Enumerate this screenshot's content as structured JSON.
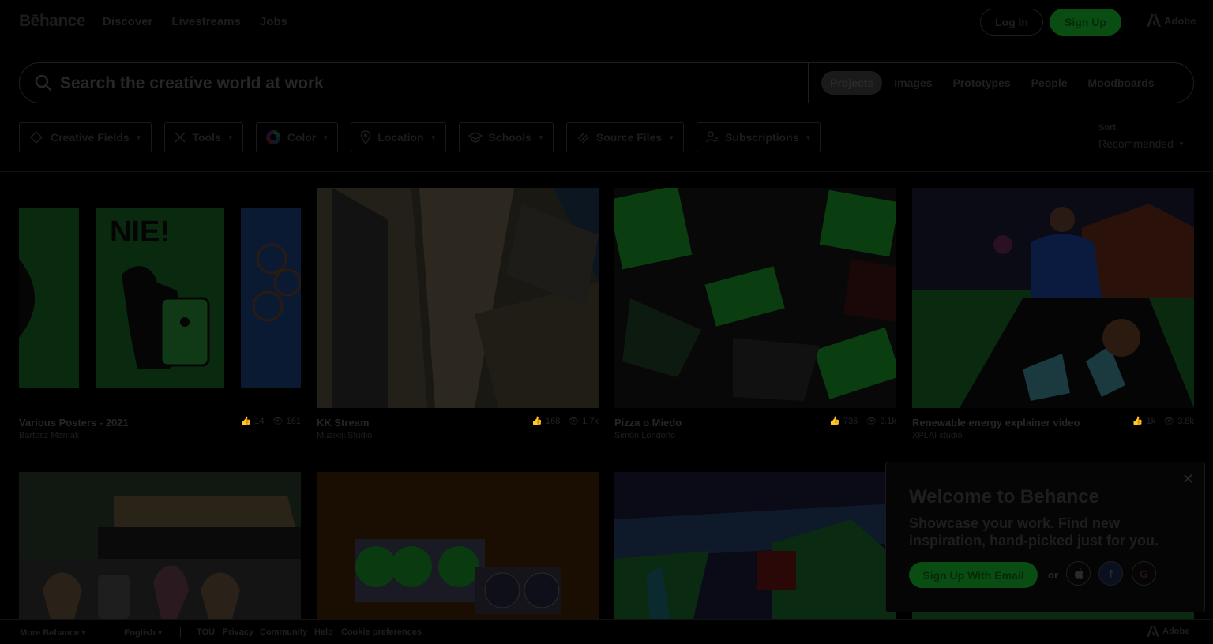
{
  "nav": {
    "logo": "Bēhance",
    "links": [
      "Discover",
      "Livestreams",
      "Jobs"
    ],
    "login": "Log In",
    "signup": "Sign Up",
    "adobe": "Adobe"
  },
  "search": {
    "placeholder": "Search the creative world at work",
    "tabs": [
      "Projects",
      "Images",
      "Prototypes",
      "People",
      "Moodboards"
    ],
    "active_tab": "Projects"
  },
  "filters": [
    "Creative Fields",
    "Tools",
    "Color",
    "Location",
    "Schools",
    "Source Files",
    "Subscriptions"
  ],
  "sort": {
    "label": "Sort",
    "value": "Recommended"
  },
  "projects": [
    {
      "title": "Various Posters - 2021",
      "owner": "Bartosz Mamak",
      "likes": "14",
      "views": "161"
    },
    {
      "title": "KK Stream",
      "owner": "Muzixiii Studio",
      "likes": "168",
      "views": "1.7k"
    },
    {
      "title": "Pizza o Miedo",
      "owner": "Simón Londoño",
      "likes": "736",
      "views": "9.1k"
    },
    {
      "title": "Renewable energy explainer video",
      "owner": "XPLAI studio",
      "likes": "1k",
      "views": "3.8k"
    }
  ],
  "welcome": {
    "title": "Welcome to Behance",
    "body": "Showcase your work. Find new inspiration, hand-picked just for you.",
    "signup": "Sign Up With Email",
    "or": "or"
  },
  "footer": {
    "more": "More Behance",
    "language": "English",
    "links": [
      "TOU",
      "Privacy",
      "Community",
      "Help",
      "Cookie preferences"
    ],
    "adobe": "Adobe"
  },
  "colors": {
    "brand_green": "#0a4d12",
    "background": "#000000"
  }
}
